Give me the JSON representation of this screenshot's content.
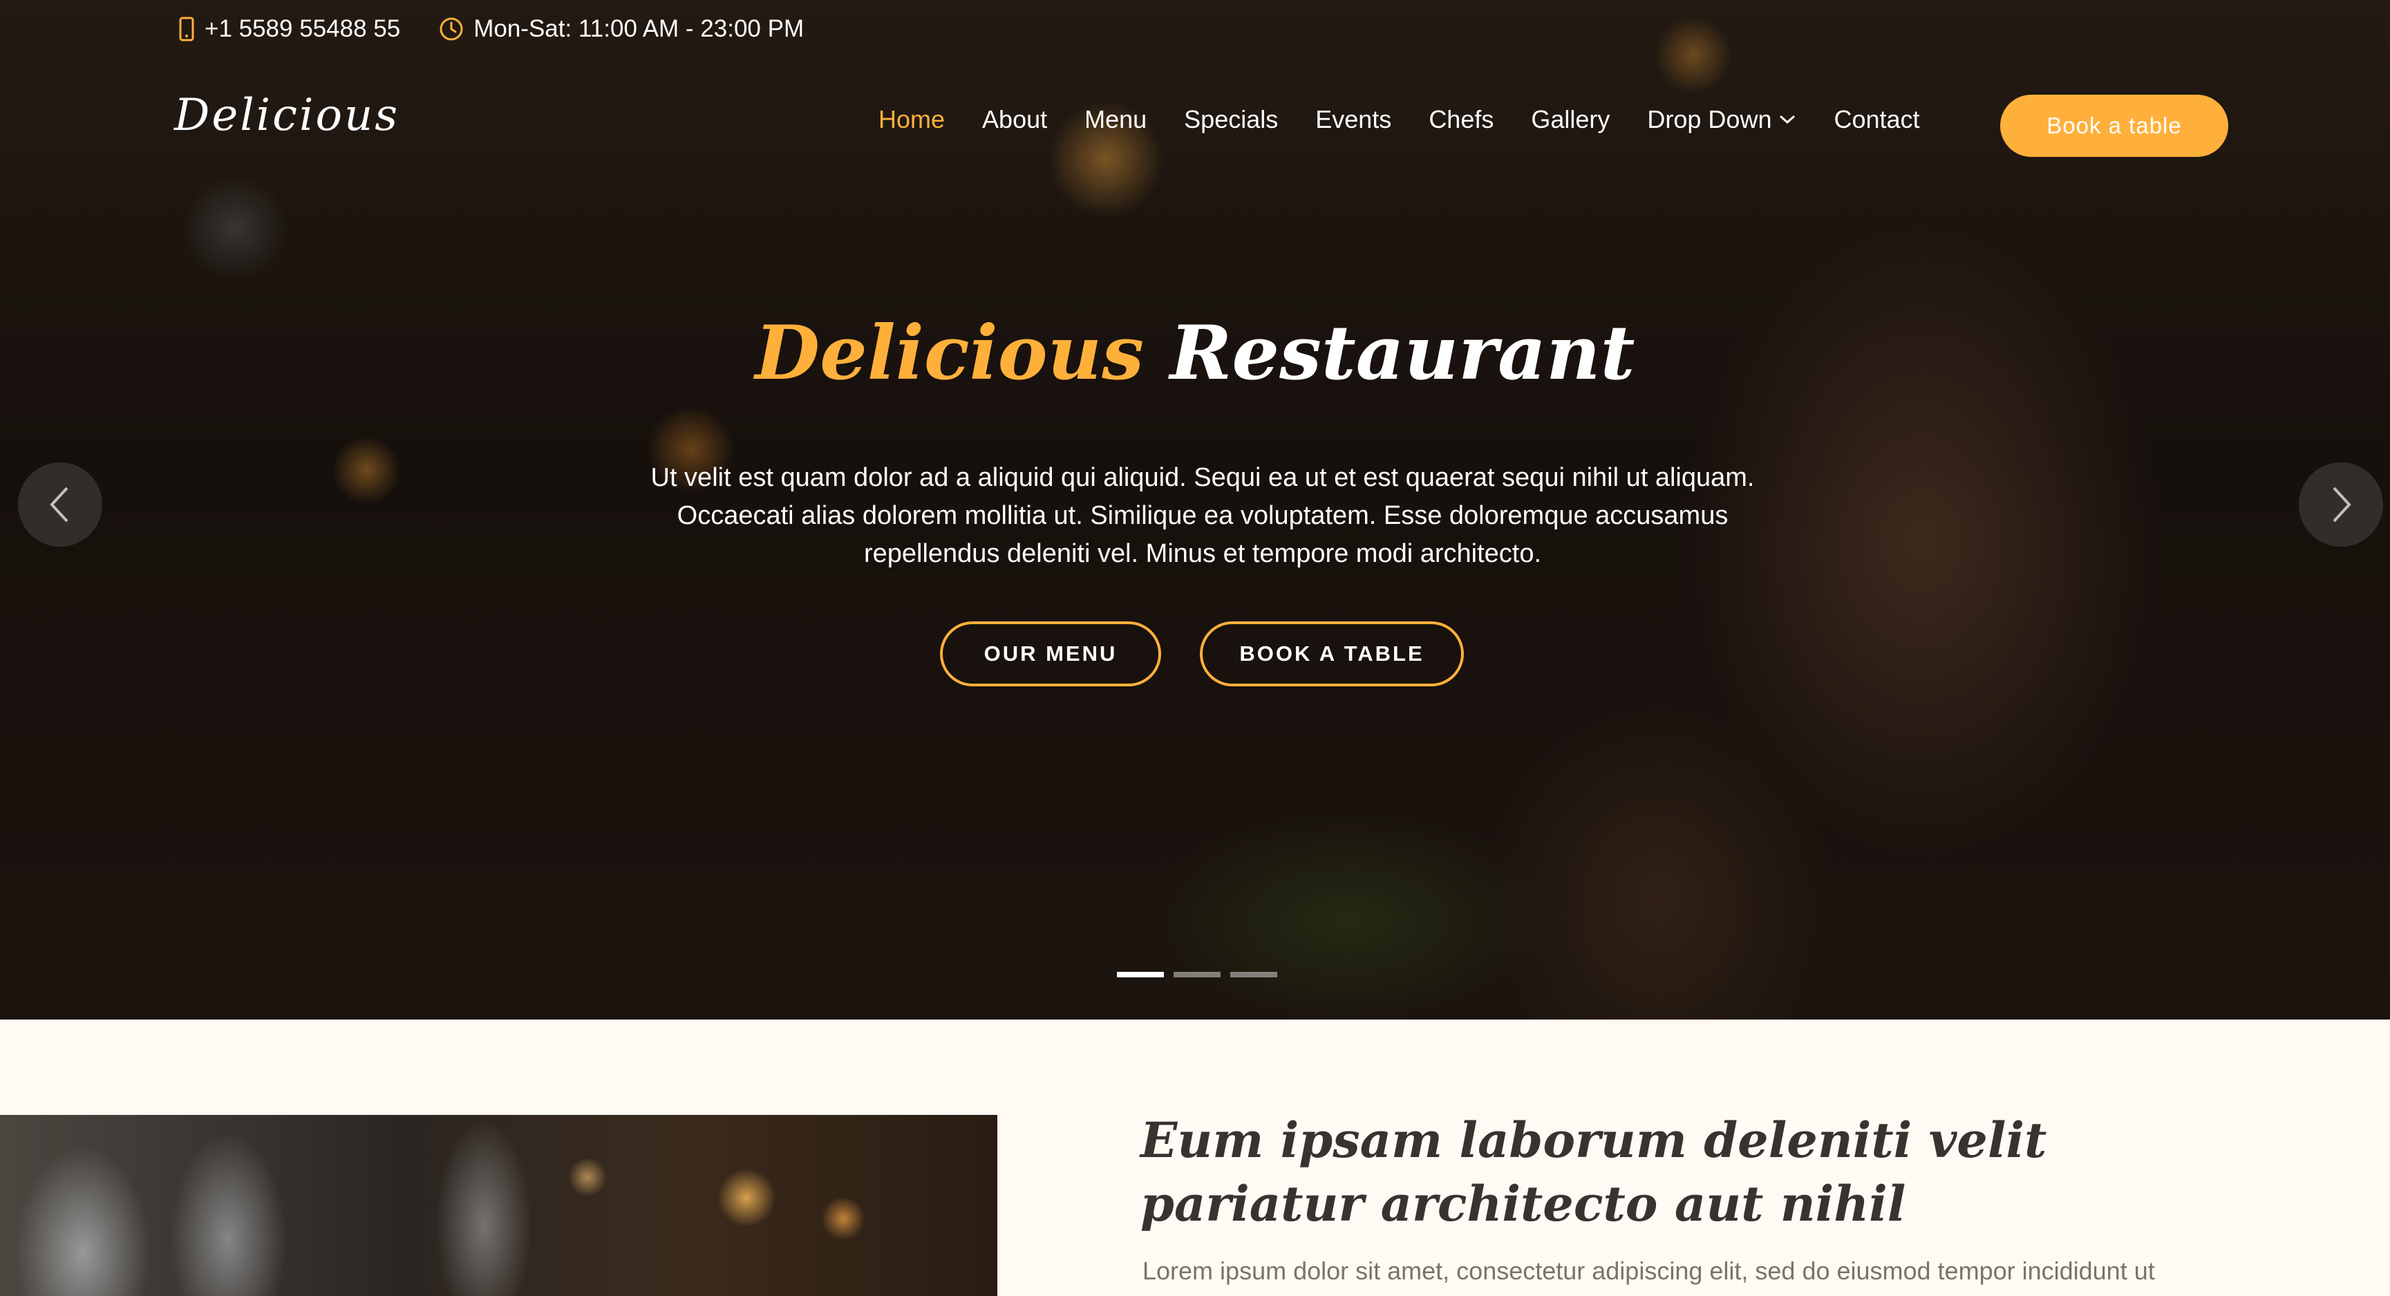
{
  "colors": {
    "accent": "#ffb03b",
    "text_dark": "#37332e",
    "section_bg": "#fffaf3"
  },
  "topbar": {
    "phone_icon": "phone-icon",
    "phone": "+1 5589 55488 55",
    "clock_icon": "clock-icon",
    "hours": "Mon-Sat: 11:00 AM - 23:00 PM"
  },
  "header": {
    "logo": "Delicious",
    "nav": {
      "home": "Home",
      "about": "About",
      "menu": "Menu",
      "specials": "Specials",
      "events": "Events",
      "chefs": "Chefs",
      "gallery": "Gallery",
      "dropdown": "Drop Down",
      "contact": "Contact"
    },
    "active_nav": "Home",
    "book_button": "Book a table"
  },
  "hero": {
    "title_accent": "Delicious",
    "title_rest": "Restaurant",
    "text": "Ut velit est quam dolor ad a aliquid qui aliquid. Sequi ea ut et est quaerat sequi nihil ut aliquam. Occaecati alias dolorem mollitia ut. Similique ea voluptatem. Esse doloremque accusamus repellendus deleniti vel. Minus et tempore modi architecto.",
    "cta_menu": "OUR MENU",
    "cta_book": "BOOK A TABLE",
    "slides_total": 3,
    "active_slide": 1
  },
  "about": {
    "heading_light": "Eum ipsam laborum deleniti",
    "heading_bold": "velit pariatur architecto aut nihil",
    "text": "Lorem ipsum dolor sit amet, consectetur adipiscing elit, sed do eiusmod tempor incididunt ut"
  }
}
